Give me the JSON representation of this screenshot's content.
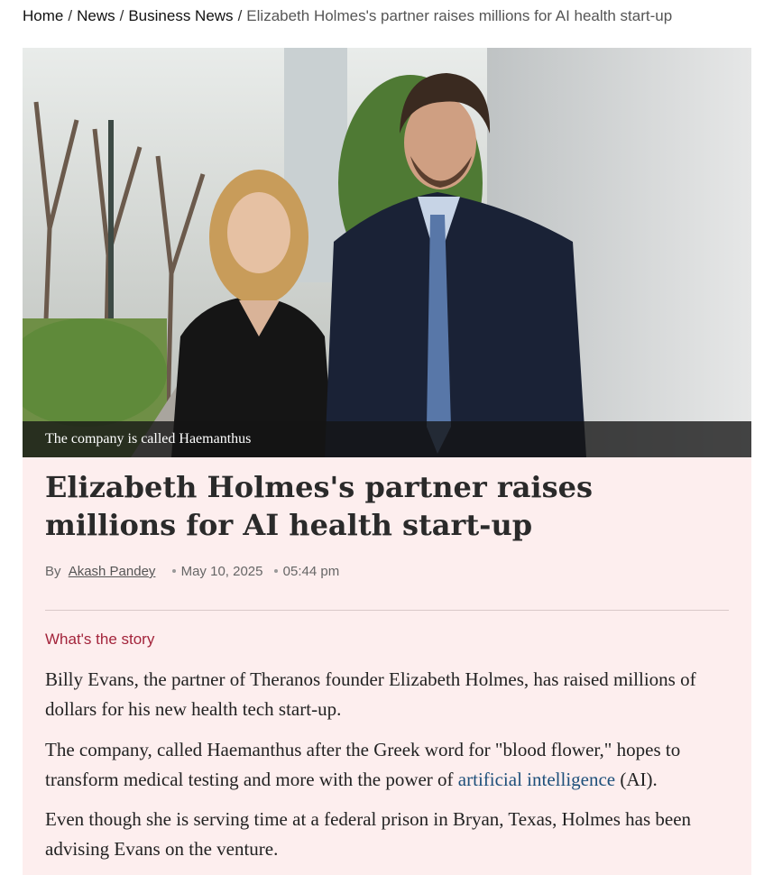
{
  "breadcrumb": {
    "home": "Home",
    "news": "News",
    "business": "Business News",
    "current": "Elizabeth Holmes's partner raises millions for AI health start-up",
    "separator": "/"
  },
  "hero": {
    "caption": "The company is called Haemanthus"
  },
  "article": {
    "title": "Elizabeth Holmes's partner raises millions for AI health start-up",
    "byline_prefix": "By",
    "author": "Akash Pandey",
    "date": "May 10, 2025",
    "time": "05:44 pm",
    "story_label": "What's the story",
    "p1": "Billy Evans, the partner of Theranos founder Elizabeth Holmes, has raised millions of dollars for his new health tech start-up.",
    "p2_before": "The company, called Haemanthus after the Greek word for \"blood flower,\" hopes to transform medical testing and more with the power of ",
    "p2_link": "artificial intelligence",
    "p2_after": " (AI).",
    "p3": "Even though she is serving time at a federal prison in Bryan, Texas, Holmes has been advising Evans on the venture."
  },
  "colors": {
    "article_bg": "#fdeeee",
    "story_label": "#a3243b",
    "link": "#1d4f7a"
  }
}
